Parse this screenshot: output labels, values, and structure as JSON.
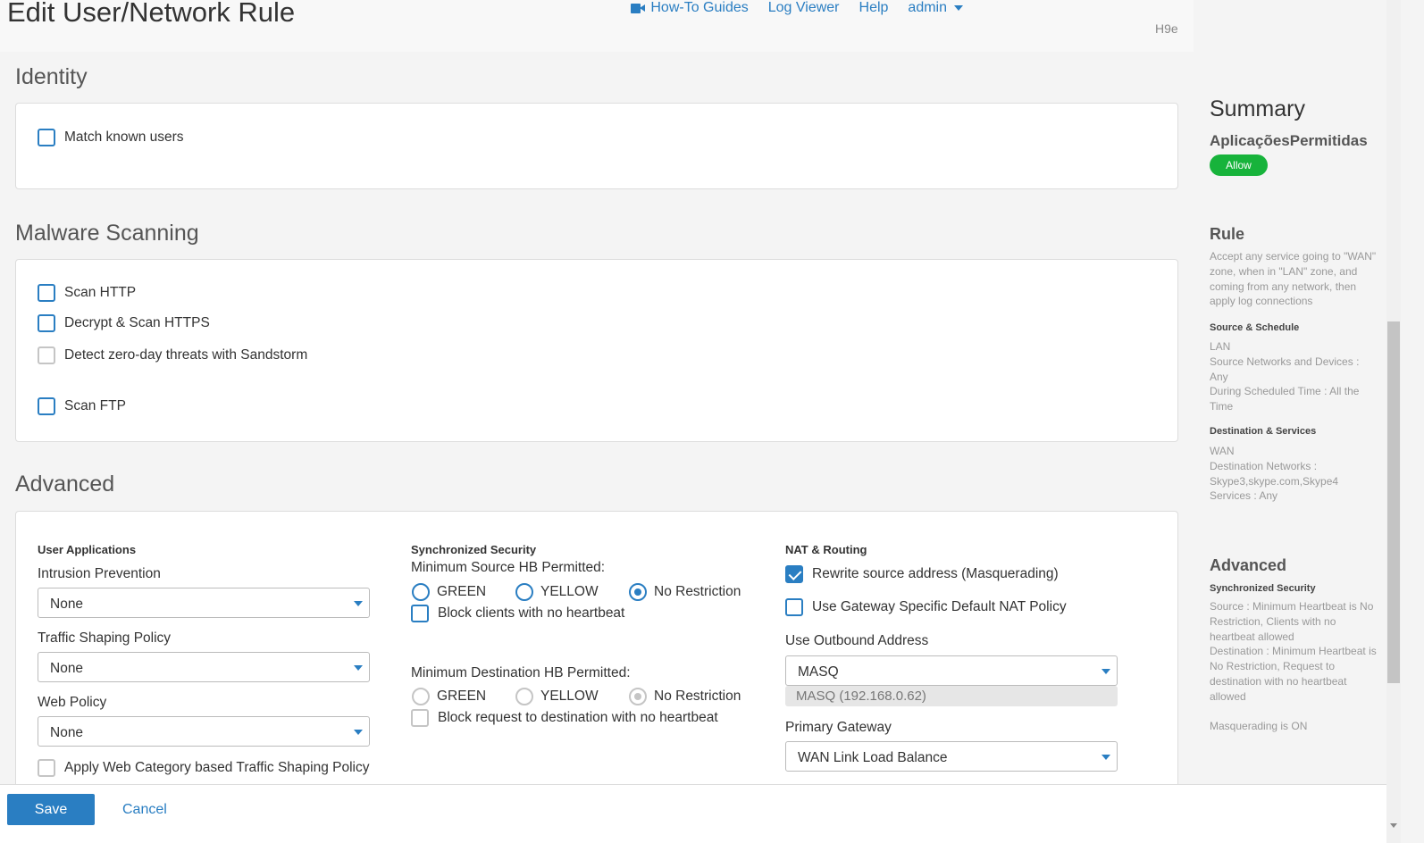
{
  "header": {
    "title": "Edit User/Network Rule",
    "nav": {
      "how_to": "How-To Guides",
      "log_viewer": "Log Viewer",
      "help": "Help",
      "user": "admin"
    },
    "device_id": "H9e"
  },
  "identity": {
    "title": "Identity",
    "match_known_users": {
      "label": "Match known users",
      "checked": false
    }
  },
  "malware": {
    "title": "Malware Scanning",
    "scan_http": "Scan HTTP",
    "decrypt_scan_https": "Decrypt & Scan HTTPS",
    "detect_zero_day": "Detect zero-day threats with Sandstorm",
    "scan_ftp": "Scan FTP"
  },
  "advanced": {
    "title": "Advanced",
    "user_apps": {
      "heading": "User Applications",
      "intrusion_label": "Intrusion Prevention",
      "intrusion_value": "None",
      "traffic_label": "Traffic Shaping Policy",
      "traffic_value": "None",
      "web_label": "Web Policy",
      "web_value": "None",
      "apply_web_category": "Apply Web Category based Traffic Shaping Policy"
    },
    "sync_security": {
      "heading": "Synchronized Security",
      "min_source_label": "Minimum Source HB Permitted:",
      "green": "GREEN",
      "yellow": "YELLOW",
      "no_restriction": "No Restriction",
      "block_clients": "Block clients with no heartbeat",
      "min_dest_label": "Minimum Destination HB Permitted:",
      "block_request": "Block request to destination with no heartbeat"
    },
    "nat": {
      "heading": "NAT & Routing",
      "rewrite_source": "Rewrite source address (Masquerading)",
      "use_gateway_nat": "Use Gateway Specific Default NAT Policy",
      "outbound_label": "Use Outbound Address",
      "outbound_value": "MASQ",
      "outbound_readonly": "MASQ (192.168.0.62)",
      "primary_gateway_label": "Primary Gateway",
      "primary_gateway_value": "WAN Link Load Balance"
    }
  },
  "footer": {
    "save": "Save",
    "cancel": "Cancel"
  },
  "summary": {
    "title": "Summary",
    "rule_name": "AplicaçõesPermitidas",
    "badge": "Allow",
    "rule_heading": "Rule",
    "rule_desc": "Accept any service going to \"WAN\" zone, when in \"LAN\" zone, and coming from any network, then apply log connections",
    "source_heading": "Source & Schedule",
    "source_text": "LAN\nSource Networks and Devices : Any\nDuring Scheduled Time : All the Time",
    "dest_heading": "Destination & Services",
    "dest_text": "WAN\nDestination Networks : Skype3,skype.com,Skype4\nServices : Any",
    "advanced_heading": "Advanced",
    "sync_heading": "Synchronized Security",
    "sync_text": "Source : Minimum Heartbeat is No Restriction, Clients with no heartbeat allowed\nDestination : Minimum Heartbeat is No Restriction, Request to destination with no heartbeat allowed",
    "masq_text": "Masquerading is ON"
  },
  "colors": {
    "accent": "#2a7ec2",
    "allow": "#17b33b"
  }
}
